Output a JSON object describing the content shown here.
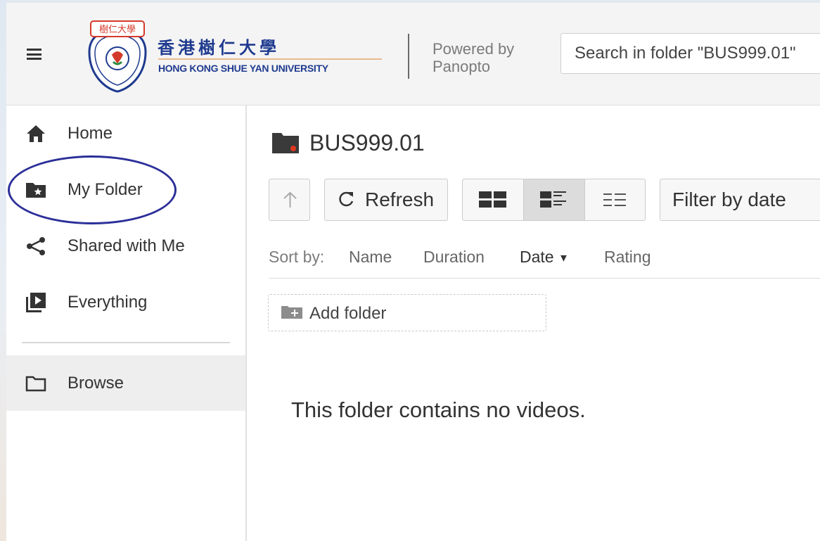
{
  "header": {
    "logo": {
      "seal_text": "樹仁大學",
      "chinese_name": "香港樹仁大學",
      "english_name": "HONG KONG SHUE YAN UNIVERSITY",
      "brand_color": "#1f3b8f"
    },
    "powered_by": {
      "line1": "Powered by",
      "line2": "Panopto"
    },
    "search": {
      "placeholder": "Search in folder \"BUS999.01\""
    }
  },
  "sidebar": {
    "items": [
      {
        "label": "Home",
        "icon": "home-icon"
      },
      {
        "label": "My Folder",
        "icon": "folder-star-icon",
        "annotated": true
      },
      {
        "label": "Shared with Me",
        "icon": "share-icon"
      },
      {
        "label": "Everything",
        "icon": "video-library-icon"
      }
    ],
    "browse": {
      "label": "Browse",
      "icon": "folder-outline-icon",
      "active": true
    }
  },
  "folder": {
    "title": "BUS999.01",
    "icon": "folder-icon",
    "accent": "#e0371f"
  },
  "toolbar": {
    "up_icon": "arrow-up-icon",
    "refresh_label": "Refresh",
    "refresh_icon": "refresh-icon",
    "views": [
      {
        "name": "thumbnail-view",
        "icon": "grid-icon",
        "selected": false
      },
      {
        "name": "detail-view",
        "icon": "detail-list-icon",
        "selected": true
      },
      {
        "name": "list-view",
        "icon": "list-icon",
        "selected": false
      }
    ],
    "filter_label": "Filter by date"
  },
  "sort": {
    "label": "Sort by:",
    "options": [
      "Name",
      "Duration",
      "Date",
      "Rating"
    ],
    "active": "Date"
  },
  "add_folder": {
    "label": "Add folder",
    "icon": "folder-plus-icon"
  },
  "empty_message": "This folder contains no videos.",
  "colors": {
    "annotation_circle": "#2b2f99",
    "header_bg": "#f4f4f4",
    "active_nav_bg": "#eeeeee"
  }
}
